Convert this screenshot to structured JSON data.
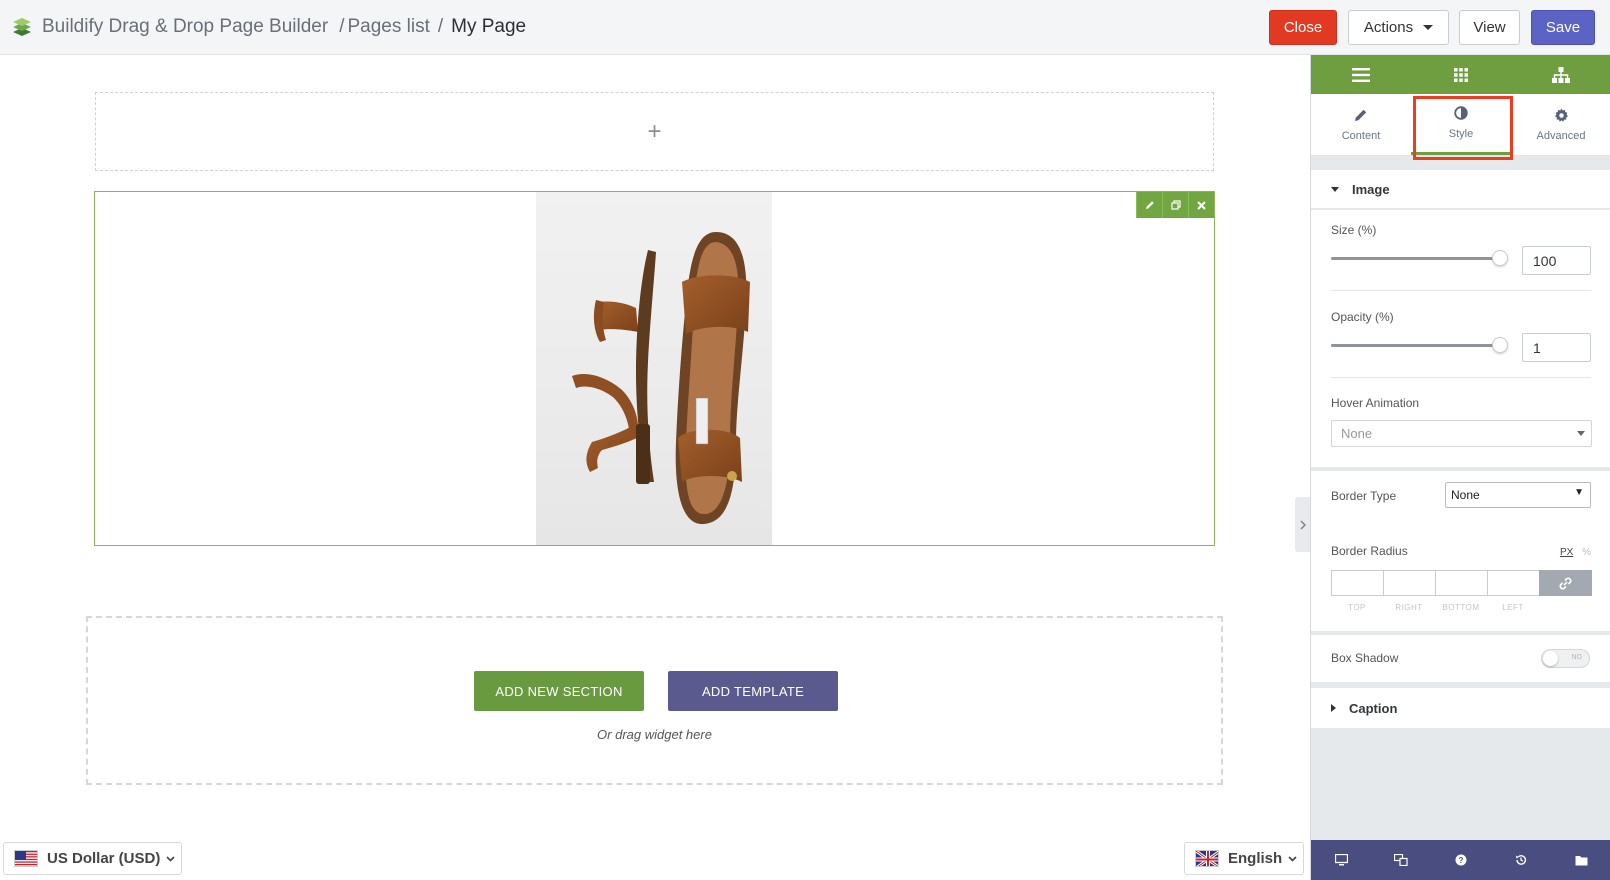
{
  "header": {
    "app_name": "Buildify Drag & Drop Page Builder",
    "sep1": "/",
    "pages_link": "Pages list",
    "sep2": "/",
    "current_page": "My Page",
    "close_label": "Close",
    "actions_label": "Actions",
    "view_label": "View",
    "save_label": "Save"
  },
  "canvas": {
    "add_section_icon": "+",
    "add_new_section_label": "ADD NEW SECTION",
    "add_template_label": "ADD TEMPLATE",
    "drag_hint": "Or drag widget here",
    "image_subject": "brown leather sandal",
    "widget_tool_icons": [
      "pencil-icon",
      "duplicate-icon",
      "close-icon"
    ]
  },
  "footer": {
    "currency_label": "US Dollar (USD)",
    "language_label": "English"
  },
  "panel": {
    "topbar_icons": [
      "menu-icon",
      "widgets-grid-icon",
      "navigator-icon"
    ],
    "tabs": [
      {
        "label": "Content",
        "icon": "pencil-icon"
      },
      {
        "label": "Style",
        "icon": "contrast-icon",
        "active": true
      },
      {
        "label": "Advanced",
        "icon": "gear-icon"
      }
    ],
    "image_section": {
      "title": "Image",
      "size_label": "Size (%)",
      "size_value": "100",
      "opacity_label": "Opacity (%)",
      "opacity_value": "1",
      "hover_label": "Hover Animation",
      "hover_value": "None"
    },
    "border_section": {
      "border_type_label": "Border Type",
      "border_type_value": "None",
      "border_radius_label": "Border Radius",
      "unit_px": "PX",
      "unit_pct": "%",
      "dims": [
        "TOP",
        "RIGHT",
        "BOTTOM",
        "LEFT"
      ]
    },
    "box_shadow_label": "Box Shadow",
    "box_shadow_toggle": "NO",
    "caption_title": "Caption",
    "footer_icons": [
      "desktop-icon",
      "responsive-icon",
      "help-icon",
      "history-icon",
      "folder-icon"
    ]
  },
  "colors": {
    "accent_green": "#6f9e40",
    "close_red": "#e23a22",
    "save_blue": "#5b63c4",
    "template_purple": "#5a5a8f",
    "highlight": "#f03c1c"
  }
}
